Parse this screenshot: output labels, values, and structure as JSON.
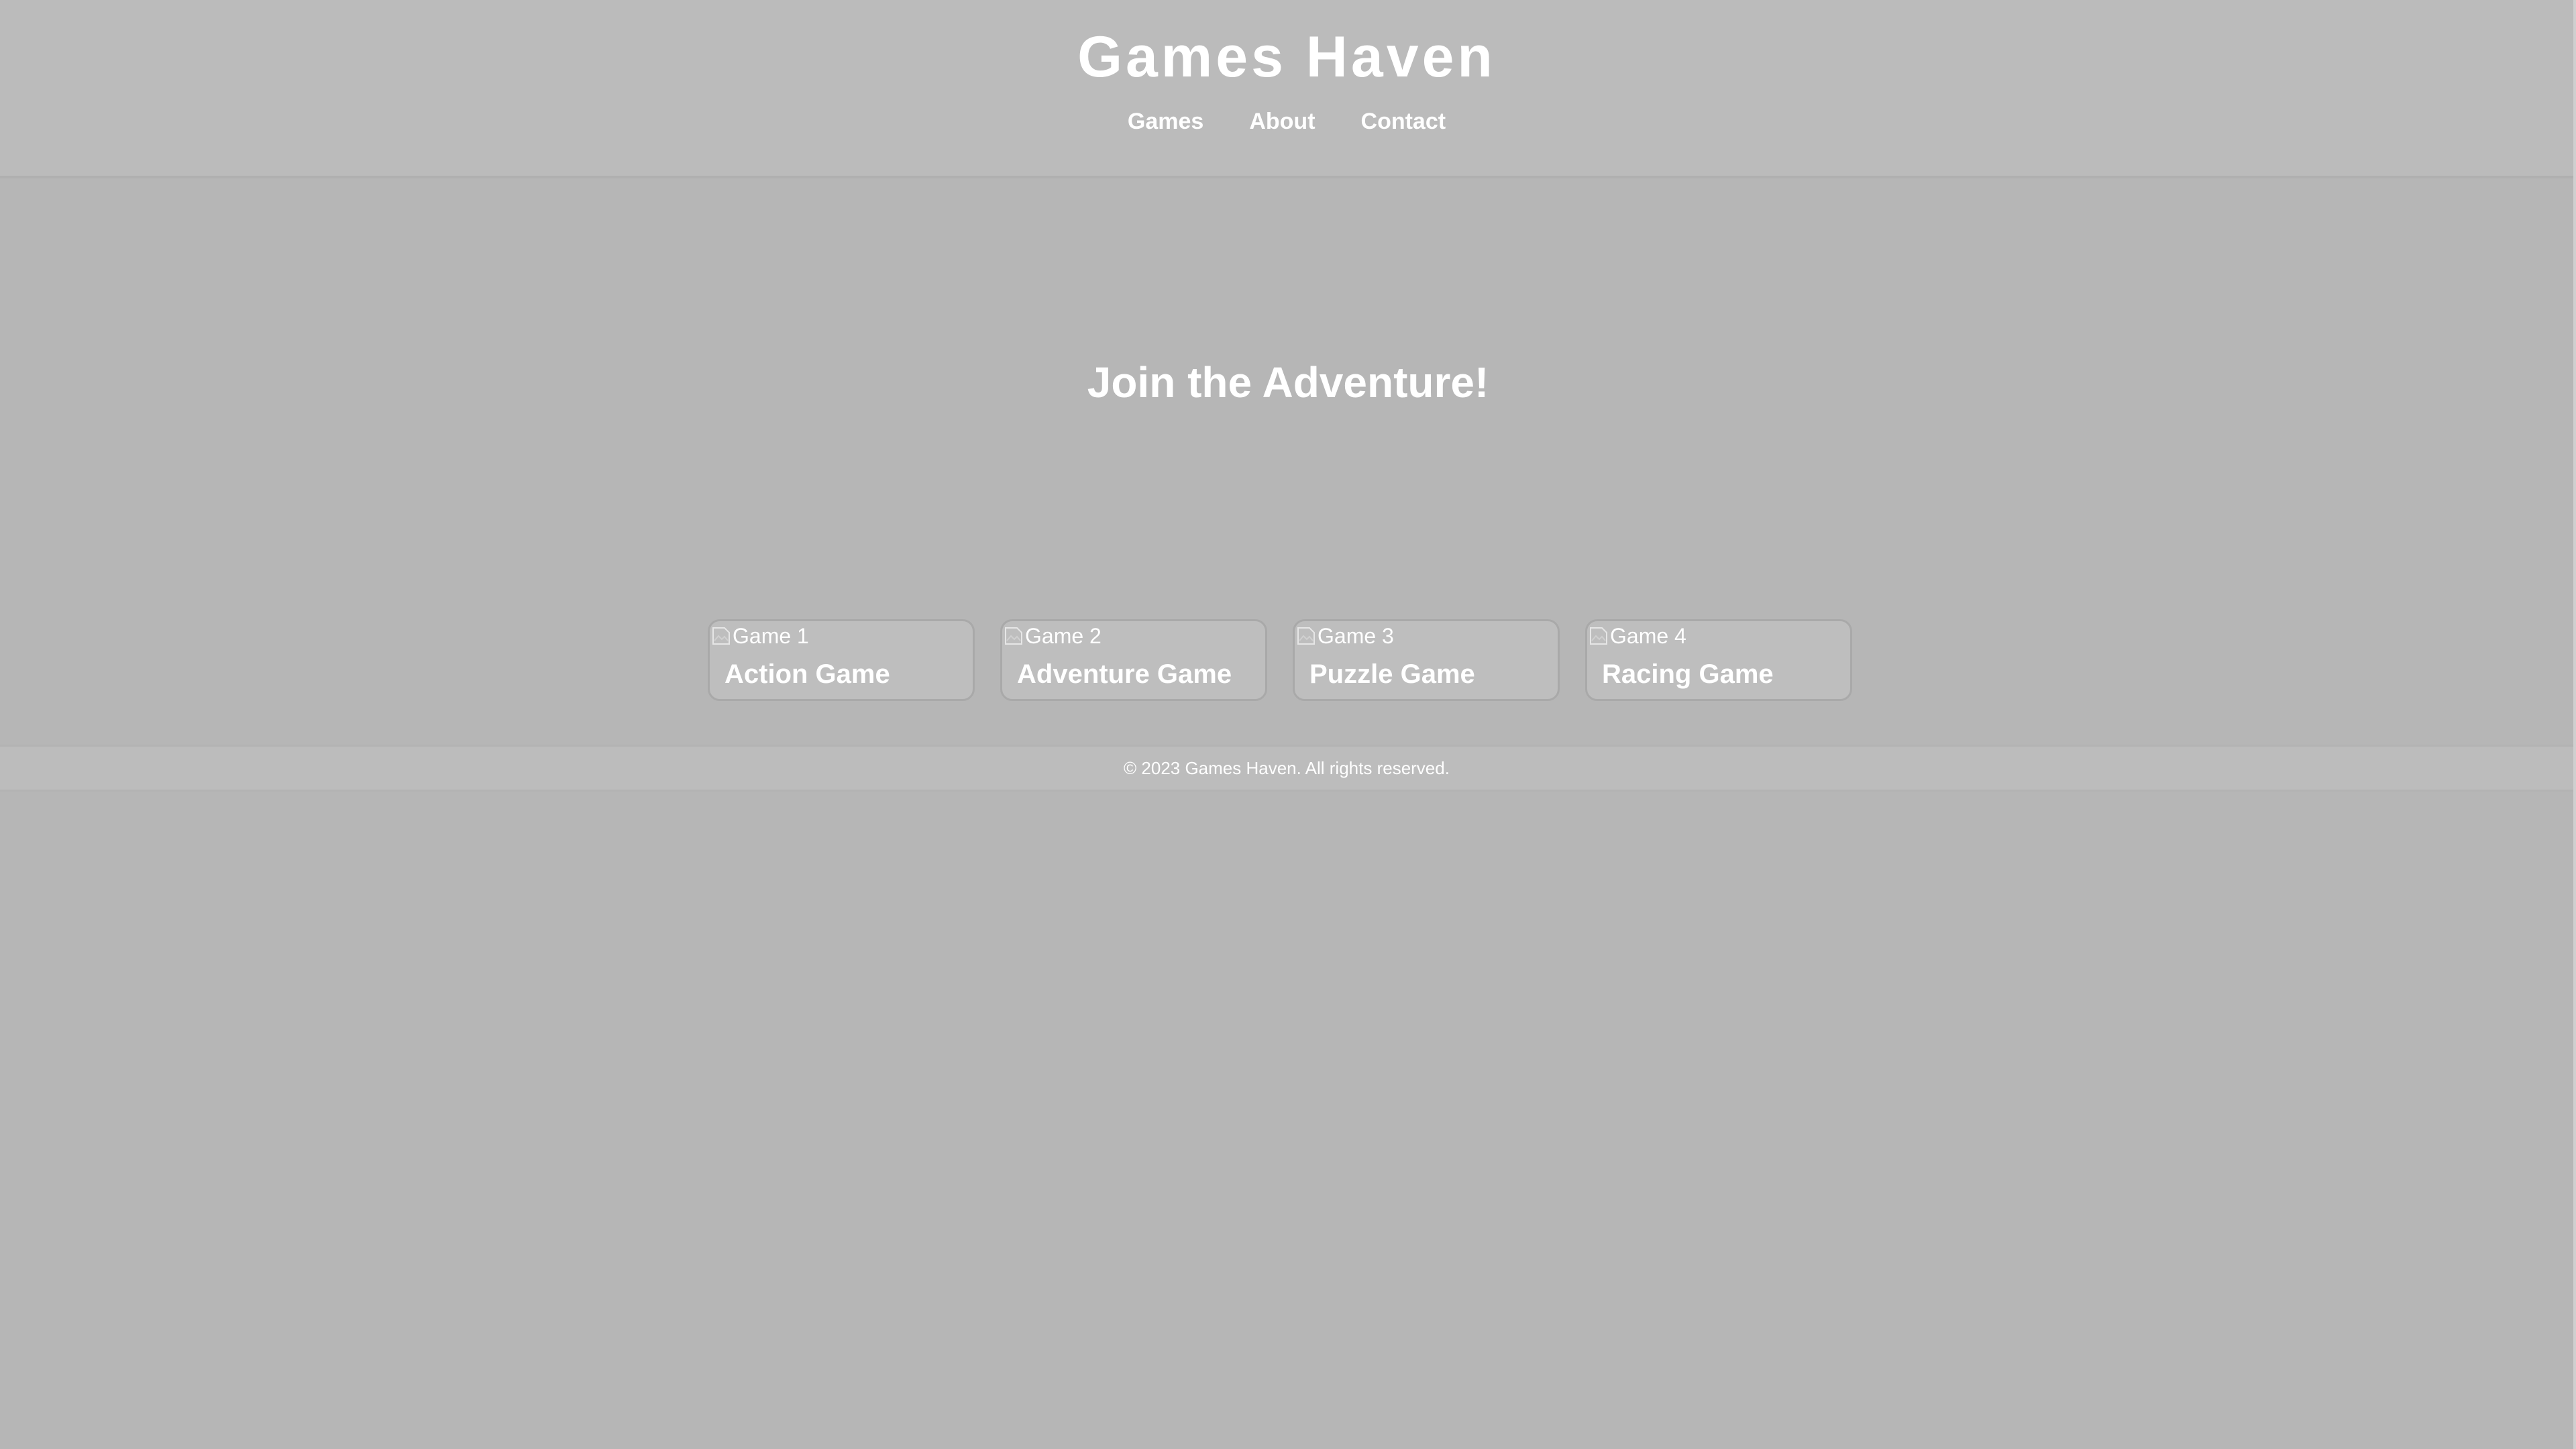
{
  "header": {
    "title": "Games Haven",
    "nav": [
      {
        "label": "Games"
      },
      {
        "label": "About"
      },
      {
        "label": "Contact"
      }
    ]
  },
  "hero": {
    "title": "Join the Adventure!"
  },
  "games": [
    {
      "alt": "Game 1",
      "name": "Action Game"
    },
    {
      "alt": "Game 2",
      "name": "Adventure Game"
    },
    {
      "alt": "Game 3",
      "name": "Puzzle Game"
    },
    {
      "alt": "Game 4",
      "name": "Racing Game"
    }
  ],
  "footer": {
    "text": "© 2023 Games Haven. All rights reserved."
  },
  "colors": {
    "background": "#b6b6b6",
    "header_bg": "#bbbbbb",
    "text": "#ffffff"
  },
  "icons": {
    "game_image": "broken-image-icon"
  }
}
